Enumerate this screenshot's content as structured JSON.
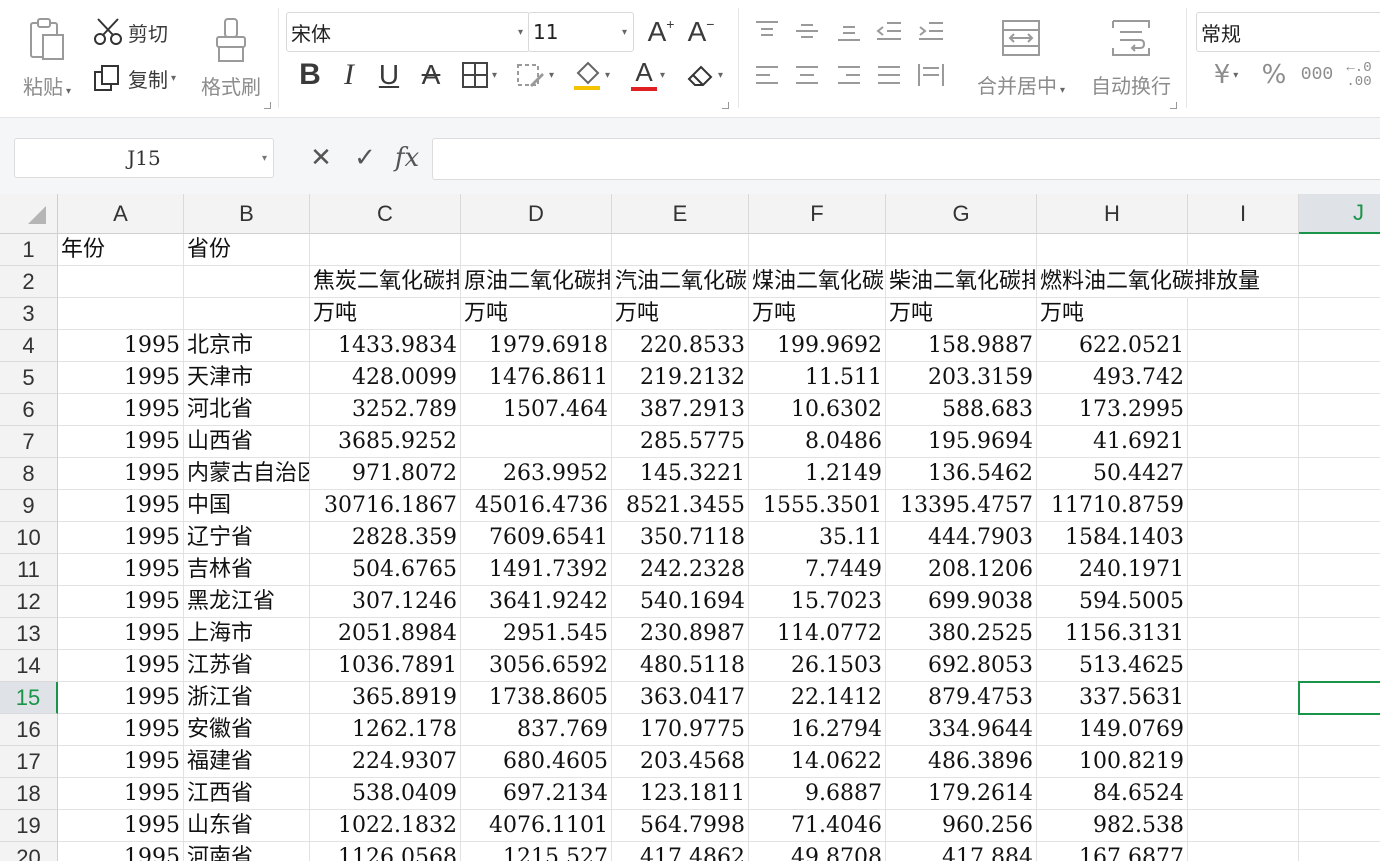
{
  "ribbon": {
    "paste": "粘贴",
    "cut": "剪切",
    "copy": "复制",
    "format_painter": "格式刷",
    "font_name": "宋体",
    "font_size": "11",
    "bold": "B",
    "italic": "I",
    "underline": "U",
    "strike": "A",
    "font_color_letter": "A",
    "merge_center": "合并居中",
    "wrap_text": "自动换行",
    "number_format": "常规",
    "currency": "¥",
    "percent": "%",
    "thousands": "000",
    "decimal": "←.0 .00",
    "font_color": "#e02020",
    "fill_color": "#f5c400"
  },
  "formula_bar": {
    "name_box": "J15",
    "cancel": "✕",
    "confirm": "✓",
    "fx": "fx",
    "value": ""
  },
  "columns": [
    "A",
    "B",
    "C",
    "D",
    "E",
    "F",
    "G",
    "H",
    "I",
    "J"
  ],
  "selected_column": "J",
  "selected_row": "15",
  "rows": [
    {
      "n": "1",
      "A": "年份",
      "B": "省份",
      "C": "",
      "D": "",
      "E": "",
      "F": "",
      "G": "",
      "H": ""
    },
    {
      "n": "2",
      "A": "",
      "B": "",
      "C": "焦炭二氧化碳排放量",
      "D": "原油二氧化碳排放量",
      "E": "汽油二氧化碳排放量",
      "F": "煤油二氧化碳排放量",
      "G": "柴油二氧化碳排放量",
      "H": "燃料油二氧化碳排放量"
    },
    {
      "n": "3",
      "A": "",
      "B": "",
      "C": "万吨",
      "D": "万吨",
      "E": "万吨",
      "F": "万吨",
      "G": "万吨",
      "H": "万吨"
    },
    {
      "n": "4",
      "A": "1995",
      "B": "北京市",
      "C": "1433.9834",
      "D": "1979.6918",
      "E": "220.8533",
      "F": "199.9692",
      "G": "158.9887",
      "H": "622.0521"
    },
    {
      "n": "5",
      "A": "1995",
      "B": "天津市",
      "C": "428.0099",
      "D": "1476.8611",
      "E": "219.2132",
      "F": "11.511",
      "G": "203.3159",
      "H": "493.742"
    },
    {
      "n": "6",
      "A": "1995",
      "B": "河北省",
      "C": "3252.789",
      "D": "1507.464",
      "E": "387.2913",
      "F": "10.6302",
      "G": "588.683",
      "H": "173.2995"
    },
    {
      "n": "7",
      "A": "1995",
      "B": "山西省",
      "C": "3685.9252",
      "D": "",
      "E": "285.5775",
      "F": "8.0486",
      "G": "195.9694",
      "H": "41.6921"
    },
    {
      "n": "8",
      "A": "1995",
      "B": "内蒙古自治区",
      "C": "971.8072",
      "D": "263.9952",
      "E": "145.3221",
      "F": "1.2149",
      "G": "136.5462",
      "H": "50.4427"
    },
    {
      "n": "9",
      "A": "1995",
      "B": "中国",
      "C": "30716.1867",
      "D": "45016.4736",
      "E": "8521.3455",
      "F": "1555.3501",
      "G": "13395.4757",
      "H": "11710.8759"
    },
    {
      "n": "10",
      "A": "1995",
      "B": "辽宁省",
      "C": "2828.359",
      "D": "7609.6541",
      "E": "350.7118",
      "F": "35.11",
      "G": "444.7903",
      "H": "1584.1403"
    },
    {
      "n": "11",
      "A": "1995",
      "B": "吉林省",
      "C": "504.6765",
      "D": "1491.7392",
      "E": "242.2328",
      "F": "7.7449",
      "G": "208.1206",
      "H": "240.1971"
    },
    {
      "n": "12",
      "A": "1995",
      "B": "黑龙江省",
      "C": "307.1246",
      "D": "3641.9242",
      "E": "540.1694",
      "F": "15.7023",
      "G": "699.9038",
      "H": "594.5005"
    },
    {
      "n": "13",
      "A": "1995",
      "B": "上海市",
      "C": "2051.8984",
      "D": "2951.545",
      "E": "230.8987",
      "F": "114.0772",
      "G": "380.2525",
      "H": "1156.3131"
    },
    {
      "n": "14",
      "A": "1995",
      "B": "江苏省",
      "C": "1036.7891",
      "D": "3056.6592",
      "E": "480.5118",
      "F": "26.1503",
      "G": "692.8053",
      "H": "513.4625"
    },
    {
      "n": "15",
      "A": "1995",
      "B": "浙江省",
      "C": "365.8919",
      "D": "1738.8605",
      "E": "363.0417",
      "F": "22.1412",
      "G": "879.4753",
      "H": "337.5631"
    },
    {
      "n": "16",
      "A": "1995",
      "B": "安徽省",
      "C": "1262.178",
      "D": "837.769",
      "E": "170.9775",
      "F": "16.2794",
      "G": "334.9644",
      "H": "149.0769"
    },
    {
      "n": "17",
      "A": "1995",
      "B": "福建省",
      "C": "224.9307",
      "D": "680.4605",
      "E": "203.4568",
      "F": "14.0622",
      "G": "486.3896",
      "H": "100.8219"
    },
    {
      "n": "18",
      "A": "1995",
      "B": "江西省",
      "C": "538.0409",
      "D": "697.2134",
      "E": "123.1811",
      "F": "9.6887",
      "G": "179.2614",
      "H": "84.6524"
    },
    {
      "n": "19",
      "A": "1995",
      "B": "山东省",
      "C": "1022.1832",
      "D": "4076.1101",
      "E": "564.7998",
      "F": "71.4046",
      "G": "960.256",
      "H": "982.538"
    },
    {
      "n": "20",
      "A": "1995",
      "B": "河南省",
      "C": "1126.0568",
      "D": "1215.527",
      "E": "417.4862",
      "F": "49.8708",
      "G": "417.884",
      "H": "167.6877"
    }
  ]
}
